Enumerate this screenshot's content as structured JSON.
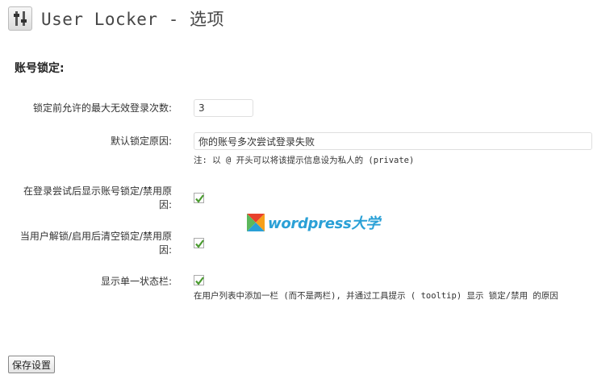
{
  "header": {
    "title": "User Locker - 选项",
    "icon": "settings-sliders-icon"
  },
  "section": {
    "title": "账号锁定:"
  },
  "fields": {
    "max_attempts": {
      "label": "锁定前允许的最大无效登录次数:",
      "value": "3"
    },
    "default_reason": {
      "label": "默认锁定原因:",
      "value": "你的账号多次尝试登录失败",
      "note": "注: 以 @ 开头可以将该提示信息设为私人的 (private)"
    },
    "show_reason_after_login": {
      "label": "在登录尝试后显示账号锁定/禁用原因:",
      "checked": true
    },
    "clear_reason_on_unlock": {
      "label": "当用户解锁/启用后清空锁定/禁用原因:",
      "checked": true
    },
    "single_status_column": {
      "label": "显示单一状态栏:",
      "checked": true,
      "note": "在用户列表中添加一栏 (而不是两栏), 并通过工具提示 ( tooltip) 显示 锁定/禁用 的原因"
    }
  },
  "watermark": {
    "text": "wordpress大学",
    "icon": "wordpress-daxue-logo-icon"
  },
  "footer": {
    "save_label": "保存设置"
  },
  "colors": {
    "checkmark": "#4a9b2f",
    "watermark": "#2aa0d6"
  }
}
